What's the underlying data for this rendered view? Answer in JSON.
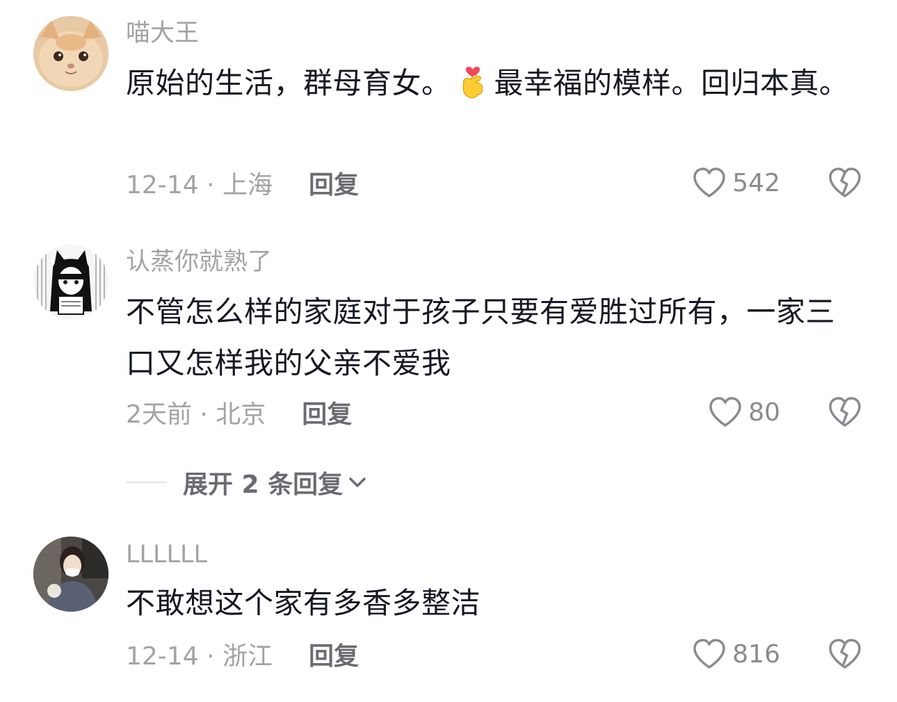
{
  "comments": [
    {
      "username": "喵大王",
      "text_before": "原始的生活，群母育女。",
      "emoji": "finger-heart-emoji",
      "text_after": "最幸福的模样。回归本真。",
      "time_location": "12-14 · 上海",
      "reply_label": "回复",
      "likes": "542",
      "avatar": "cat-avatar"
    },
    {
      "username": "认蒸你就熟了",
      "text": "不管怎么样的家庭对于孩子只要有爱胜过所有，一家三口又怎样我的父亲不爱我",
      "time_location": "2天前 · 北京",
      "reply_label": "回复",
      "likes": "80",
      "avatar": "manga-girl-avatar"
    },
    {
      "username": "LLLLLL",
      "text": "不敢想这个家有多香多整洁",
      "time_location": "12-14 · 浙江",
      "reply_label": "回复",
      "likes": "816",
      "avatar": "photo-girl-avatar"
    }
  ],
  "expand_replies": {
    "label": "展开 2 条回复"
  },
  "colors": {
    "username": "#a3a3a6",
    "body": "#161823",
    "meta": "#a3a3a6",
    "reply": "#6b6b72",
    "icon_stroke": "#8a8a90"
  }
}
